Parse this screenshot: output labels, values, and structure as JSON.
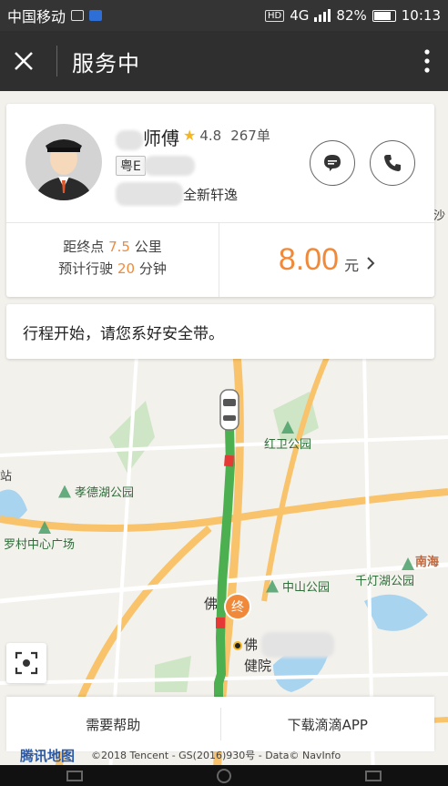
{
  "status_bar": {
    "carrier": "中国移动",
    "network": "4G",
    "network2": "4G",
    "hd": "HD",
    "battery": "82%",
    "time": "10:13"
  },
  "header": {
    "title": "服务中",
    "close_icon": "close-icon",
    "more_icon": "more-vertical-icon"
  },
  "driver": {
    "name_suffix": "师傅",
    "rating": "4.8",
    "orders": "267单",
    "plate_prefix": "粤E",
    "car_model_suffix": "全新轩逸",
    "message_icon": "message-icon",
    "phone_icon": "phone-icon"
  },
  "trip": {
    "distance_label_pre": "距终点",
    "distance_value": "7.5",
    "distance_unit": "公里",
    "time_label_pre": "预计行驶",
    "time_value": "20",
    "time_unit": "分钟",
    "price": "8.00",
    "price_unit": "元"
  },
  "notice": "行程开始，请您系好安全带。",
  "map": {
    "labels": {
      "hongwei_park": "红卫公园",
      "xiaodehu_park": "孝德湖公园",
      "luocun_square": "罗村中心广场",
      "zhongshan_park": "中山公园",
      "qiandenghu_park": "千灯湖公园",
      "nanhai": "南海",
      "zhan": "站",
      "sha": "沙",
      "fo": "佛",
      "fo_jian": "佛",
      "jianyuan": "健院",
      "end_marker": "终"
    },
    "route_color": "#4caf50",
    "congestion_color": "#e53935",
    "accent_color": "#f08a3a"
  },
  "bottom_bar": {
    "help": "需要帮助",
    "download": "下载滴滴APP"
  },
  "map_footer": {
    "logo": "腾讯地图",
    "copyright": "©2018 Tencent - GS(2016)930号 - Data© NavInfo"
  }
}
